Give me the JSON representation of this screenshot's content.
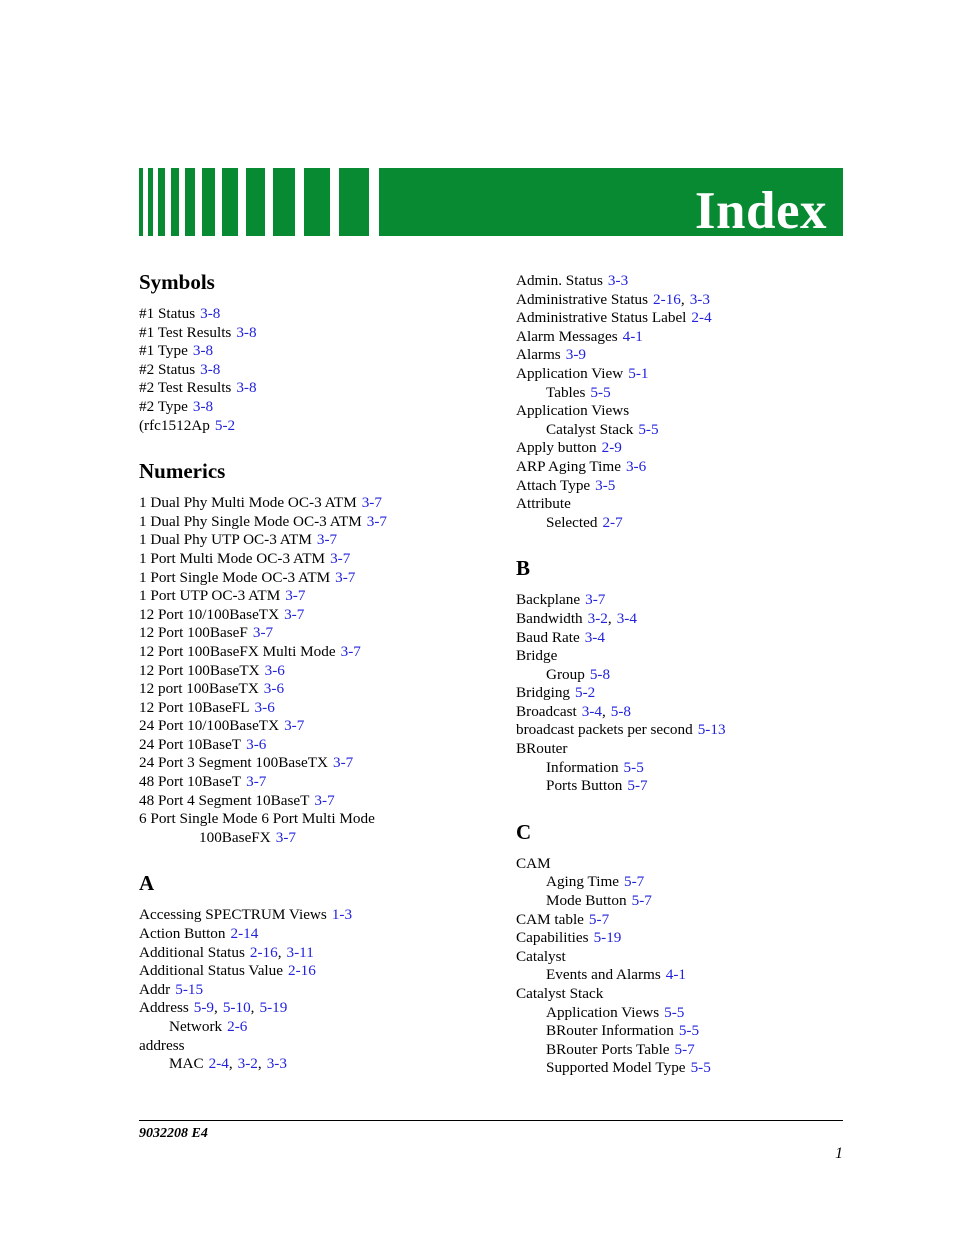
{
  "header": {
    "title": "Index",
    "banner_color": "#078A32",
    "barcode": {
      "bars": [
        4,
        5,
        7,
        8,
        10,
        13,
        16,
        19,
        22,
        26,
        30,
        35
      ],
      "gaps": [
        5,
        5,
        6,
        6,
        7,
        7,
        8,
        8,
        9,
        9,
        10
      ]
    }
  },
  "reference_color": "#2222DD",
  "columns": {
    "left": [
      {
        "heading": "Symbols",
        "entries": [
          {
            "text": "#1 Status",
            "refs": [
              "3-8"
            ],
            "level": 0
          },
          {
            "text": "#1 Test Results",
            "refs": [
              "3-8"
            ],
            "level": 0
          },
          {
            "text": "#1 Type",
            "refs": [
              "3-8"
            ],
            "level": 0
          },
          {
            "text": "#2 Status",
            "refs": [
              "3-8"
            ],
            "level": 0
          },
          {
            "text": "#2 Test Results",
            "refs": [
              "3-8"
            ],
            "level": 0
          },
          {
            "text": "#2 Type",
            "refs": [
              "3-8"
            ],
            "level": 0
          },
          {
            "text": "(rfc1512Ap",
            "refs": [
              "5-2"
            ],
            "level": 0
          }
        ]
      },
      {
        "heading": "Numerics",
        "entries": [
          {
            "text": "1 Dual Phy Multi Mode OC-3 ATM",
            "refs": [
              "3-7"
            ],
            "level": 0
          },
          {
            "text": "1 Dual Phy Single Mode OC-3 ATM",
            "refs": [
              "3-7"
            ],
            "level": 0
          },
          {
            "text": "1 Dual Phy UTP OC-3 ATM",
            "refs": [
              "3-7"
            ],
            "level": 0
          },
          {
            "text": "1 Port Multi Mode OC-3 ATM",
            "refs": [
              "3-7"
            ],
            "level": 0
          },
          {
            "text": "1 Port Single Mode OC-3 ATM",
            "refs": [
              "3-7"
            ],
            "level": 0
          },
          {
            "text": "1 Port UTP OC-3 ATM",
            "refs": [
              "3-7"
            ],
            "level": 0
          },
          {
            "text": "12 Port 10/100BaseTX",
            "refs": [
              "3-7"
            ],
            "level": 0
          },
          {
            "text": "12 Port 100BaseF",
            "refs": [
              "3-7"
            ],
            "level": 0
          },
          {
            "text": "12 Port 100BaseFX Multi Mode",
            "refs": [
              "3-7"
            ],
            "level": 0
          },
          {
            "text": "12 Port 100BaseTX",
            "refs": [
              "3-6"
            ],
            "level": 0
          },
          {
            "text": "12 port 100BaseTX",
            "refs": [
              "3-6"
            ],
            "level": 0
          },
          {
            "text": "12 Port 10BaseFL",
            "refs": [
              "3-6"
            ],
            "level": 0
          },
          {
            "text": "24 Port 10/100BaseTX",
            "refs": [
              "3-7"
            ],
            "level": 0
          },
          {
            "text": "24 Port 10BaseT",
            "refs": [
              "3-6"
            ],
            "level": 0
          },
          {
            "text": "24 Port 3 Segment 100BaseTX",
            "refs": [
              "3-7"
            ],
            "level": 0
          },
          {
            "text": "48 Port 10BaseT",
            "refs": [
              "3-7"
            ],
            "level": 0
          },
          {
            "text": "48 Port 4 Segment 10BaseT",
            "refs": [
              "3-7"
            ],
            "level": 0
          },
          {
            "text": "6 Port Single Mode 6 Port Multi Mode",
            "refs": [],
            "level": 0
          },
          {
            "text": "100BaseFX",
            "refs": [
              "3-7"
            ],
            "level": 2
          }
        ]
      },
      {
        "heading": "A",
        "entries": [
          {
            "text": "Accessing SPECTRUM Views",
            "refs": [
              "1-3"
            ],
            "level": 0
          },
          {
            "text": "Action Button",
            "refs": [
              "2-14"
            ],
            "level": 0
          },
          {
            "text": "Additional Status",
            "refs": [
              "2-16",
              "3-11"
            ],
            "level": 0
          },
          {
            "text": "Additional Status Value",
            "refs": [
              "2-16"
            ],
            "level": 0
          },
          {
            "text": "Addr",
            "refs": [
              "5-15"
            ],
            "level": 0
          },
          {
            "text": "Address",
            "refs": [
              "5-9",
              "5-10",
              "5-19"
            ],
            "level": 0
          },
          {
            "text": "Network",
            "refs": [
              "2-6"
            ],
            "level": 1
          },
          {
            "text": "address",
            "refs": [],
            "level": 0
          },
          {
            "text": "MAC",
            "refs": [
              "2-4",
              "3-2",
              "3-3"
            ],
            "level": 1
          }
        ]
      }
    ],
    "right": [
      {
        "heading": "",
        "entries": [
          {
            "text": "Admin. Status",
            "refs": [
              "3-3"
            ],
            "level": 0
          },
          {
            "text": "Administrative Status",
            "refs": [
              "2-16",
              "3-3"
            ],
            "level": 0
          },
          {
            "text": "Administrative Status Label",
            "refs": [
              "2-4"
            ],
            "level": 0
          },
          {
            "text": "Alarm Messages",
            "refs": [
              "4-1"
            ],
            "level": 0
          },
          {
            "text": "Alarms",
            "refs": [
              "3-9"
            ],
            "level": 0
          },
          {
            "text": "Application View",
            "refs": [
              "5-1"
            ],
            "level": 0
          },
          {
            "text": "Tables",
            "refs": [
              "5-5"
            ],
            "level": 1
          },
          {
            "text": "Application Views",
            "refs": [],
            "level": 0
          },
          {
            "text": "Catalyst Stack",
            "refs": [
              "5-5"
            ],
            "level": 1
          },
          {
            "text": "Apply button",
            "refs": [
              "2-9"
            ],
            "level": 0
          },
          {
            "text": "ARP Aging Time",
            "refs": [
              "3-6"
            ],
            "level": 0
          },
          {
            "text": "Attach Type",
            "refs": [
              "3-5"
            ],
            "level": 0
          },
          {
            "text": "Attribute",
            "refs": [],
            "level": 0
          },
          {
            "text": "Selected",
            "refs": [
              "2-7"
            ],
            "level": 1
          }
        ]
      },
      {
        "heading": "B",
        "entries": [
          {
            "text": "Backplane",
            "refs": [
              "3-7"
            ],
            "level": 0
          },
          {
            "text": "Bandwidth",
            "refs": [
              "3-2",
              "3-4"
            ],
            "level": 0
          },
          {
            "text": "Baud Rate",
            "refs": [
              "3-4"
            ],
            "level": 0
          },
          {
            "text": "Bridge",
            "refs": [],
            "level": 0
          },
          {
            "text": "Group",
            "refs": [
              "5-8"
            ],
            "level": 1
          },
          {
            "text": "Bridging",
            "refs": [
              "5-2"
            ],
            "level": 0
          },
          {
            "text": "Broadcast",
            "refs": [
              "3-4",
              "5-8"
            ],
            "level": 0
          },
          {
            "text": "broadcast packets per second",
            "refs": [
              "5-13"
            ],
            "level": 0
          },
          {
            "text": "BRouter",
            "refs": [],
            "level": 0
          },
          {
            "text": "Information",
            "refs": [
              "5-5"
            ],
            "level": 1
          },
          {
            "text": "Ports Button",
            "refs": [
              "5-7"
            ],
            "level": 1
          }
        ]
      },
      {
        "heading": "C",
        "entries": [
          {
            "text": "CAM",
            "refs": [],
            "level": 0
          },
          {
            "text": "Aging Time",
            "refs": [
              "5-7"
            ],
            "level": 1
          },
          {
            "text": "Mode Button",
            "refs": [
              "5-7"
            ],
            "level": 1
          },
          {
            "text": "CAM table",
            "refs": [
              "5-7"
            ],
            "level": 0
          },
          {
            "text": "Capabilities",
            "refs": [
              "5-19"
            ],
            "level": 0
          },
          {
            "text": "Catalyst",
            "refs": [],
            "level": 0
          },
          {
            "text": "Events and Alarms",
            "refs": [
              "4-1"
            ],
            "level": 1
          },
          {
            "text": "Catalyst Stack",
            "refs": [],
            "level": 0
          },
          {
            "text": "Application Views",
            "refs": [
              "5-5"
            ],
            "level": 1
          },
          {
            "text": "BRouter Information",
            "refs": [
              "5-5"
            ],
            "level": 1
          },
          {
            "text": "BRouter Ports Table",
            "refs": [
              "5-7"
            ],
            "level": 1
          },
          {
            "text": "Supported Model Type",
            "refs": [
              "5-5"
            ],
            "level": 1
          }
        ]
      }
    ]
  },
  "footer": {
    "document_number": "9032208 E4",
    "page_number": "1"
  }
}
